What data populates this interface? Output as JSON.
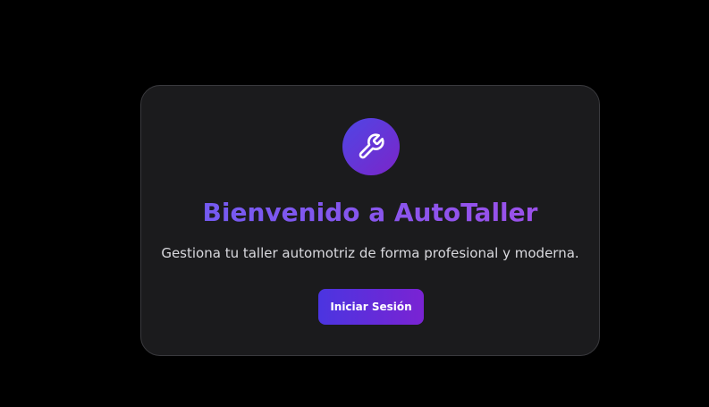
{
  "hero": {
    "icon": "wrench-icon",
    "title": "Bienvenido a AutoTaller",
    "subtitle": "Gestiona tu taller automotriz de forma profesional y moderna.",
    "login_label": "Iniciar Sesión"
  },
  "colors": {
    "background": "#000000",
    "card": "#1b1b1d",
    "accent_start": "#4f46e5",
    "accent_end": "#7b25c9",
    "title_start": "#6d5cf2",
    "title_end": "#a24fe9",
    "subtitle_text": "#d9d9de"
  }
}
